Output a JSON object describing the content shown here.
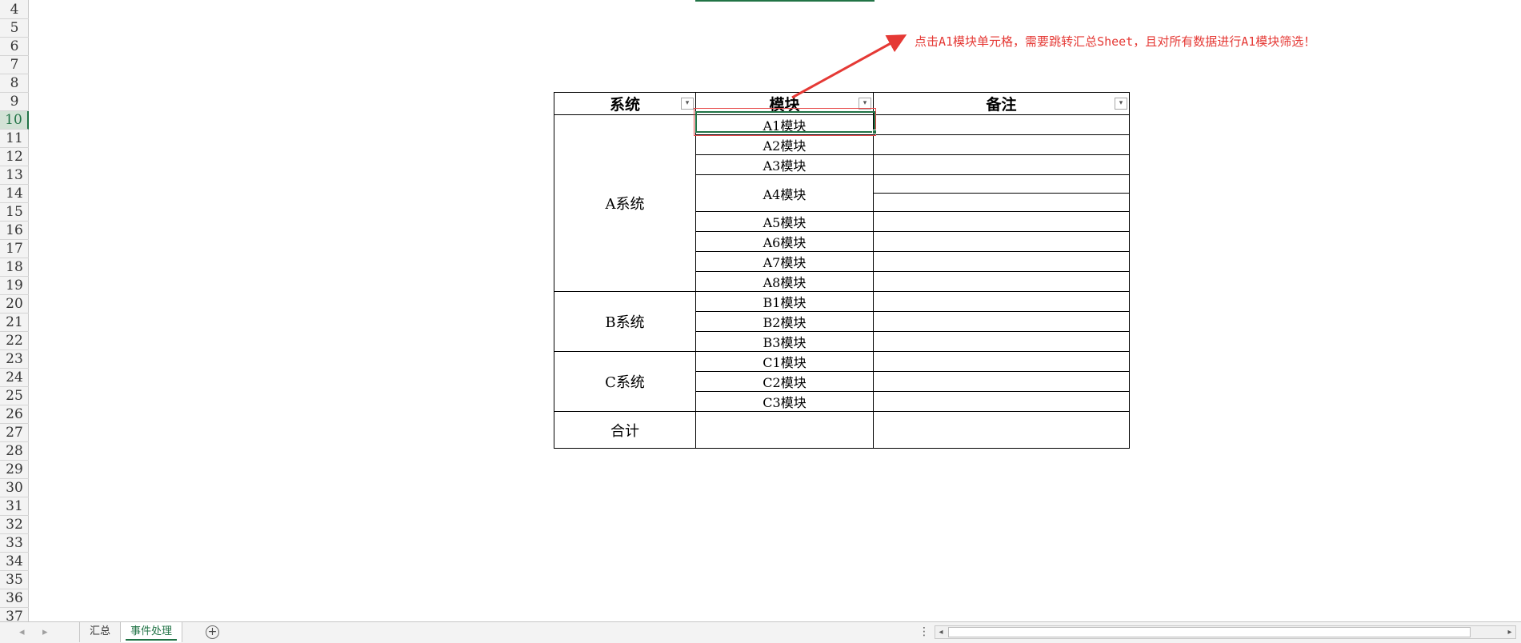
{
  "row_numbers": [
    "4",
    "5",
    "6",
    "7",
    "8",
    "9",
    "10",
    "11",
    "12",
    "13",
    "14",
    "15",
    "16",
    "17",
    "18",
    "19",
    "20",
    "21",
    "22",
    "23",
    "24",
    "25",
    "26",
    "27",
    "28",
    "29",
    "30",
    "31",
    "32",
    "33",
    "34",
    "35",
    "36",
    "37"
  ],
  "active_row": "10",
  "table": {
    "headers": {
      "system": "系统",
      "module": "模块",
      "note": "备注"
    },
    "filter_glyph": "▾",
    "systems": {
      "a": "A系统",
      "b": "B系统",
      "c": "C系统",
      "total": "合计"
    },
    "modules": [
      "A1模块",
      "A2模块",
      "A3模块",
      "A4模块",
      "A5模块",
      "A6模块",
      "A7模块",
      "A8模块",
      "B1模块",
      "B2模块",
      "B3模块",
      "C1模块",
      "C2模块",
      "C3模块"
    ]
  },
  "annotation": {
    "text": "点击A1模块单元格，需要跳转汇总Sheet，且对所有数据进行A1模块筛选！",
    "color": "#e53935"
  },
  "tabbar": {
    "tabs": [
      "汇总",
      "事件处理"
    ],
    "active_tab": "事件处理",
    "nav_prev": "◂",
    "nav_next": "▸",
    "add_icon": "+",
    "dots": "⋮",
    "scroll_left": "◂",
    "scroll_right": "▸"
  },
  "colors": {
    "accent": "#217346",
    "highlight": "#e74c4c"
  }
}
